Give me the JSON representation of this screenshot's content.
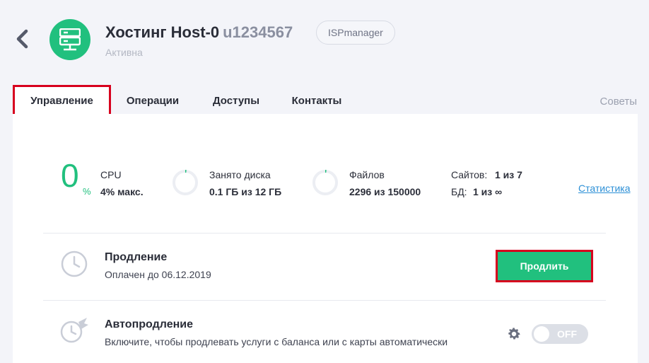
{
  "header": {
    "title": "Хостинг Host-0",
    "login": "u1234567",
    "panel": "ISPmanager",
    "status": "Активна"
  },
  "tabs": [
    {
      "label": "Управление",
      "active": true
    },
    {
      "label": "Операции",
      "active": false
    },
    {
      "label": "Доступы",
      "active": false
    },
    {
      "label": "Контакты",
      "active": false
    }
  ],
  "tips_label": "Советы",
  "stats": {
    "cpu": {
      "value": "0",
      "unit": "%",
      "label": "CPU",
      "sub": "4% макс."
    },
    "disk": {
      "label": "Занято диска",
      "value": "0.1 ГБ из 12 ГБ"
    },
    "files": {
      "label": "Файлов",
      "value": "2296 из 150000"
    },
    "sites": {
      "label": "Сайтов:",
      "value": "1 из 7"
    },
    "db": {
      "label": "БД:",
      "value": "1 из ∞"
    },
    "link": "Статистика"
  },
  "renewal": {
    "title": "Продление",
    "subtitle": "Оплачен до 06.12.2019",
    "button": "Продлить"
  },
  "autorenew": {
    "title": "Автопродление",
    "subtitle": "Включите, чтобы продлевать услуги с баланса или с карты автоматически",
    "toggle": "OFF"
  },
  "colors": {
    "accent": "#21c07e",
    "highlight": "#d7001e",
    "link": "#2b8fd6"
  }
}
